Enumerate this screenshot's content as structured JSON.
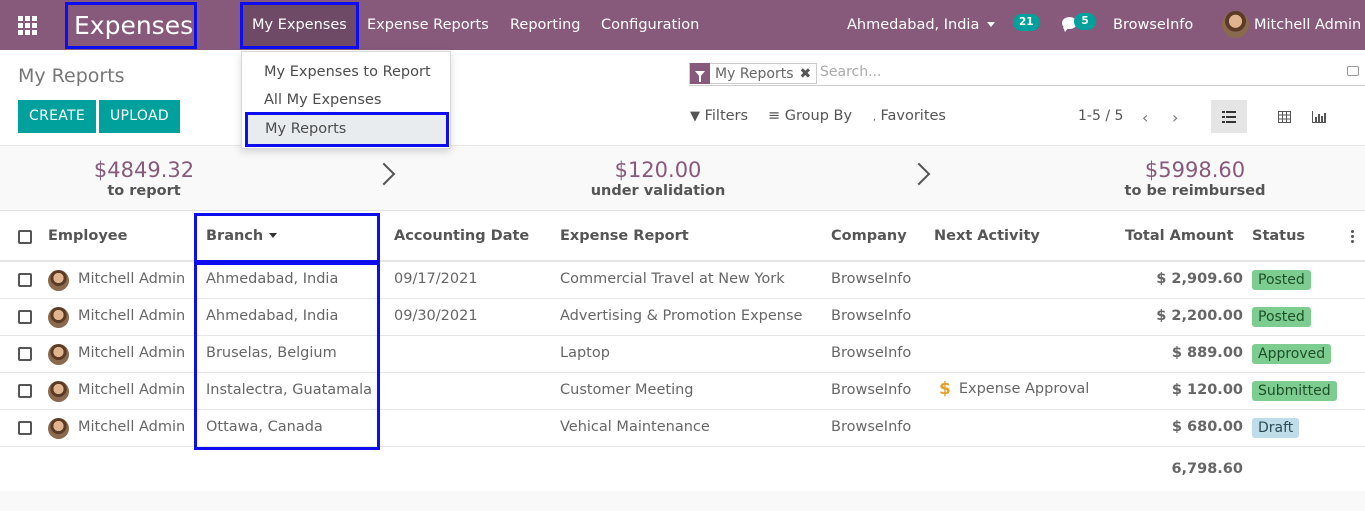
{
  "navbar": {
    "app_title": "Expenses",
    "menus": [
      "My Expenses",
      "Expense Reports",
      "Reporting",
      "Configuration"
    ],
    "branch_selector": "Ahmedabad, India",
    "activity_count": "21",
    "message_count": "5",
    "company": "BrowseInfo",
    "user": "Mitchell Admin"
  },
  "dropdown": {
    "items": [
      "My Expenses to Report",
      "All My Expenses",
      "My Reports"
    ],
    "selected": "My Reports"
  },
  "control_panel": {
    "title": "My Reports",
    "create_label": "CREATE",
    "upload_label": "UPLOAD",
    "facet": "My Reports",
    "search_placeholder": "Search...",
    "filters_label": "Filters",
    "group_by_label": "Group By",
    "favorites_label": "Favorites",
    "pager": "1-5 / 5"
  },
  "summary": [
    {
      "amount": "$4849.32",
      "label": "to report"
    },
    {
      "amount": "$120.00",
      "label": "under validation"
    },
    {
      "amount": "$5998.60",
      "label": "to be reimbursed"
    }
  ],
  "table": {
    "columns": [
      "Employee",
      "Branch",
      "Accounting Date",
      "Expense Report",
      "Company",
      "Next Activity",
      "Total Amount",
      "Status"
    ],
    "rows": [
      {
        "employee": "Mitchell Admin",
        "branch": "Ahmedabad, India",
        "date": "09/17/2021",
        "report": "Commercial Travel at New York",
        "company": "BrowseInfo",
        "activity": "",
        "amount": "$ 2,909.60",
        "status": "Posted"
      },
      {
        "employee": "Mitchell Admin",
        "branch": "Ahmedabad, India",
        "date": "09/30/2021",
        "report": "Advertising & Promotion Expense",
        "company": "BrowseInfo",
        "activity": "",
        "amount": "$ 2,200.00",
        "status": "Posted"
      },
      {
        "employee": "Mitchell Admin",
        "branch": "Bruselas, Belgium",
        "date": "",
        "report": "Laptop",
        "company": "BrowseInfo",
        "activity": "",
        "amount": "$ 889.00",
        "status": "Approved"
      },
      {
        "employee": "Mitchell Admin",
        "branch": "Instalectra, Guatamala",
        "date": "",
        "report": "Customer Meeting",
        "company": "BrowseInfo",
        "activity": "Expense Approval",
        "amount": "$ 120.00",
        "status": "Submitted"
      },
      {
        "employee": "Mitchell Admin",
        "branch": "Ottawa, Canada",
        "date": "",
        "report": "Vehical Maintenance",
        "company": "BrowseInfo",
        "activity": "",
        "amount": "$ 680.00",
        "status": "Draft"
      }
    ],
    "total": "6,798.60"
  },
  "colors": {
    "navbar": "#875a7b",
    "primary_button": "#00a09d",
    "highlight_border": "#0d0df0",
    "status_posted": "#7ccd8f",
    "status_approved": "#7ccd8f",
    "status_submitted": "#7ccd8f",
    "status_draft": "#bfdde9"
  }
}
